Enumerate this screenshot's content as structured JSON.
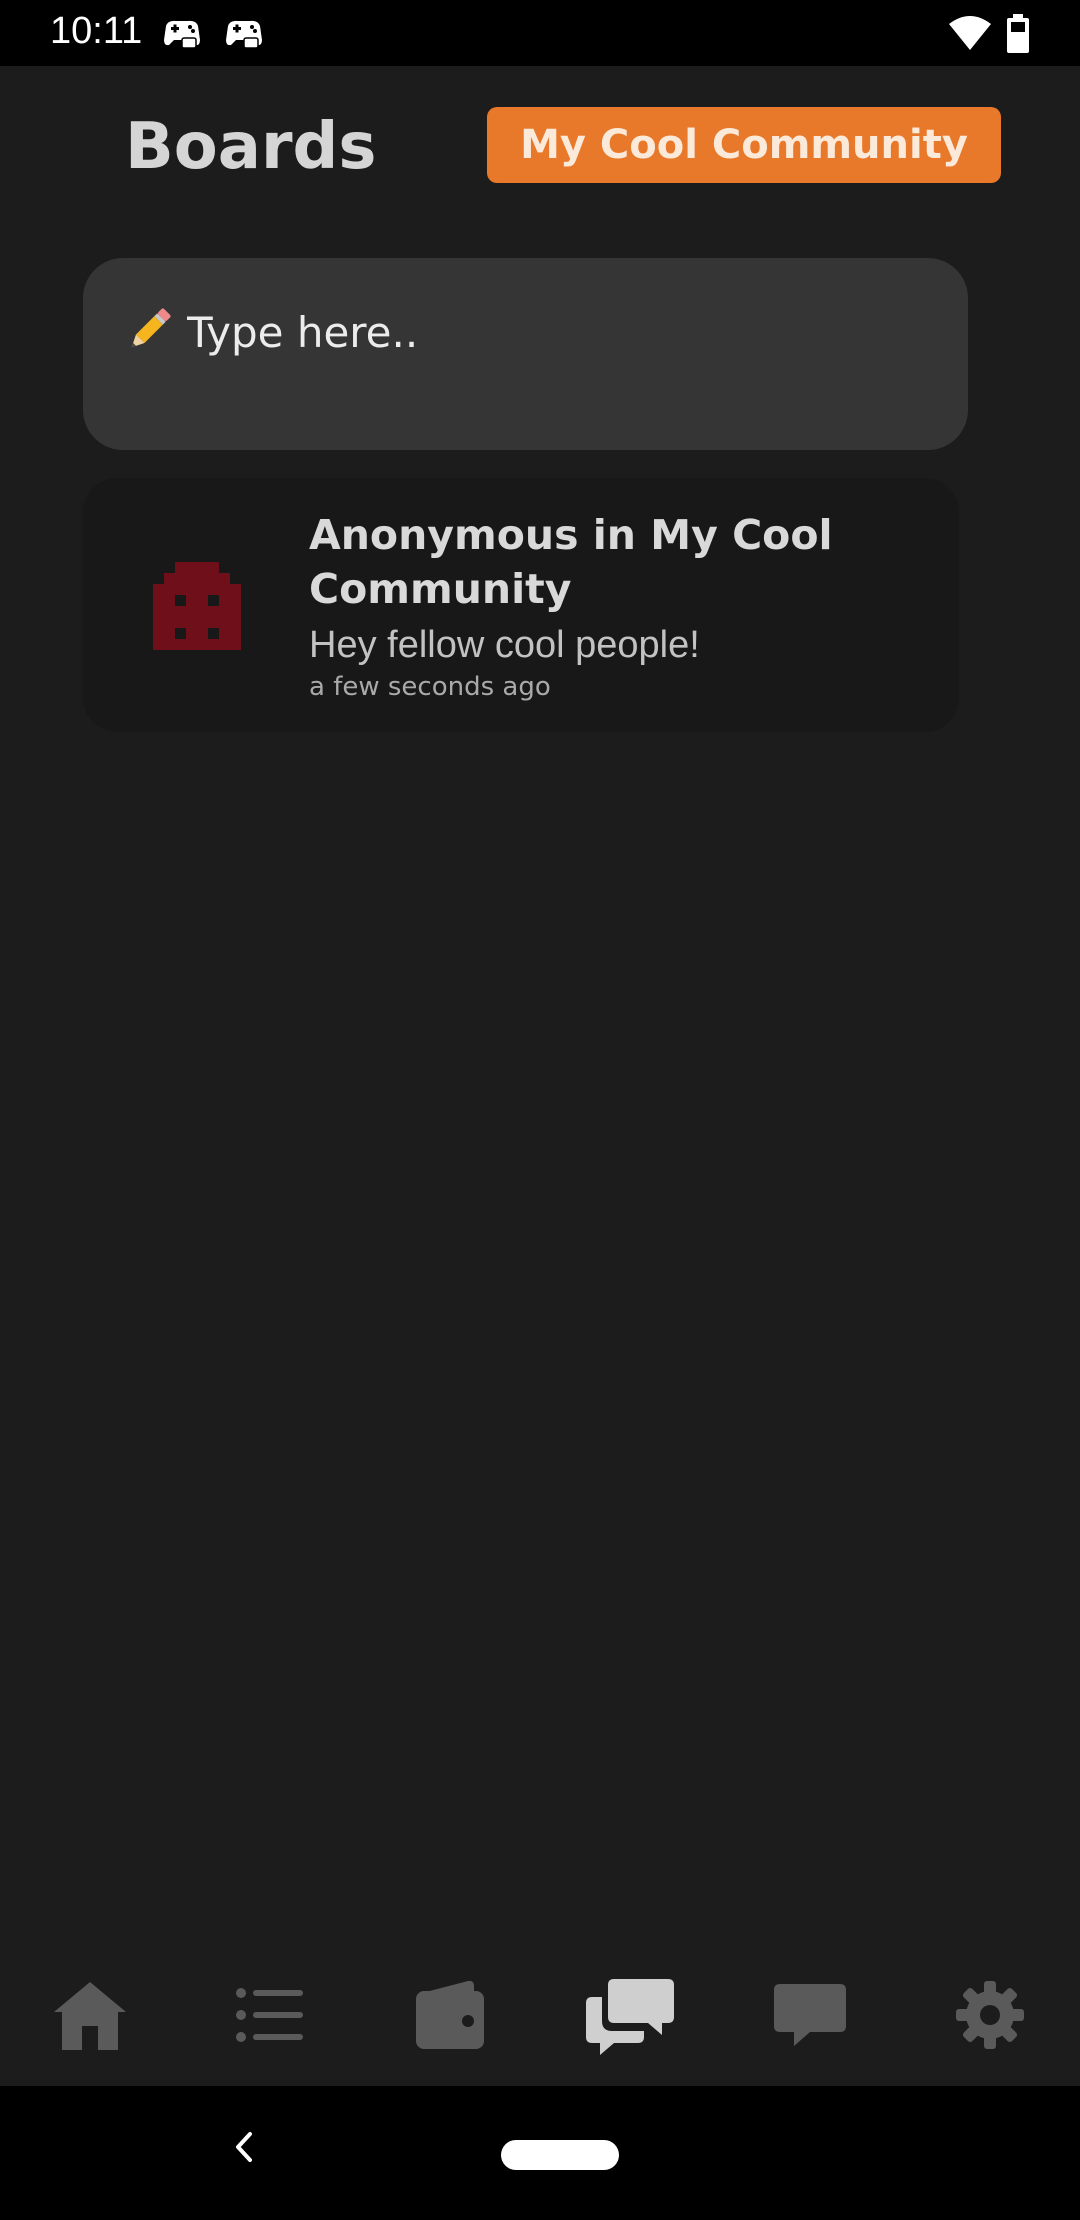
{
  "status_bar": {
    "time": "10:11",
    "icons": [
      "game-controller-icon",
      "game-controller-icon",
      "wifi-icon",
      "battery-icon"
    ]
  },
  "header": {
    "title": "Boards",
    "community_button": "My Cool Community"
  },
  "compose": {
    "icon": "pencil-icon",
    "placeholder": "Type here.."
  },
  "posts": [
    {
      "author_line": "Anonymous in My Cool Community",
      "body": "Hey fellow cool people!",
      "time": "a few seconds ago",
      "avatar": "pixel-invader-avatar",
      "avatar_color": "#6e0f1a"
    }
  ],
  "bottom_nav": {
    "items": [
      "home-icon",
      "list-icon",
      "wallet-icon",
      "boards-chat-icon",
      "message-icon",
      "settings-icon"
    ],
    "active": "boards-chat-icon",
    "active_color": "#cfcfcf",
    "inactive_color": "#5a5a5a"
  },
  "colors": {
    "background": "#1c1c1d",
    "accent": "#e8782a",
    "compose_background": "#353535",
    "card_background": "#181818"
  }
}
